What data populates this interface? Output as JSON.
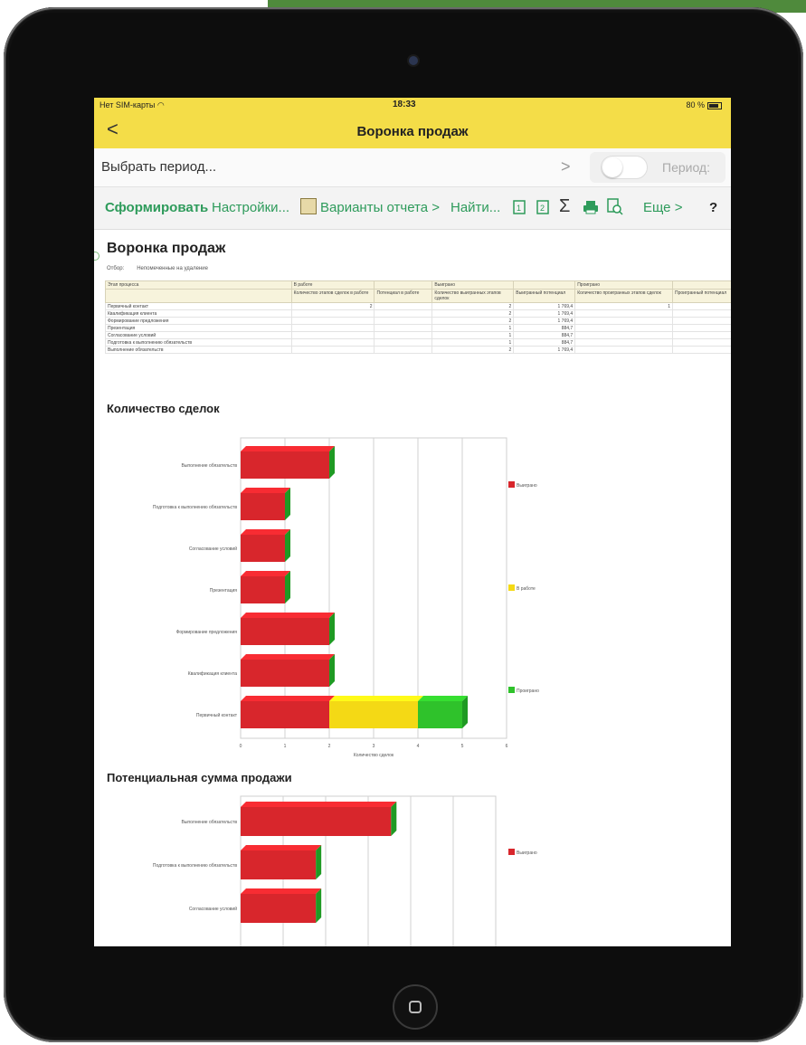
{
  "status": {
    "carrier": "Нет SIM-карты",
    "time": "18:33",
    "battery": "80 %"
  },
  "nav": {
    "back": "<",
    "title": "Воронка продаж"
  },
  "period": {
    "select": "Выбрать период...",
    "chevron": ">",
    "label": "Период:"
  },
  "toolbar": {
    "generate": "Сформировать",
    "settings": "Настройки...",
    "variants": "Варианты отчета >",
    "find": "Найти...",
    "sum": "Σ",
    "more": "Еще >",
    "help": "?"
  },
  "report": {
    "title": "Воронка продаж",
    "filter_label": "Отбор:",
    "filter_value": "Непомеченные на удаление"
  },
  "table": {
    "header_top": [
      "Этап процесса",
      "В работе",
      "",
      "Выиграно",
      "",
      "Проиграно",
      ""
    ],
    "header_sub": [
      "",
      "Количество этапов сделок в работе",
      "Потенциал в работе",
      "Количество выигранных этапов сделок",
      "Выигранный потенциал",
      "Количество проигранных этапов сделок",
      "Проигранный потенциал"
    ],
    "rows": [
      [
        "Первичный контакт",
        "2",
        "",
        "2",
        "1 769,4",
        "1",
        ""
      ],
      [
        "Квалификация клиента",
        "",
        "",
        "2",
        "1 769,4",
        "",
        ""
      ],
      [
        "Формирование предложения",
        "",
        "",
        "2",
        "1 769,4",
        "",
        ""
      ],
      [
        "Презентация",
        "",
        "",
        "1",
        "884,7",
        "",
        ""
      ],
      [
        "Согласование условий",
        "",
        "",
        "1",
        "884,7",
        "",
        ""
      ],
      [
        "Подготовка к выполнению обязательств",
        "",
        "",
        "1",
        "884,7",
        "",
        ""
      ],
      [
        "Выполнение обязательств",
        "",
        "",
        "2",
        "1 769,4",
        "",
        ""
      ]
    ]
  },
  "chart_data": [
    {
      "type": "bar",
      "orientation": "horizontal",
      "stacked": true,
      "title": "Количество сделок",
      "xlabel": "Количество сделок",
      "ylabel": "",
      "xlim": [
        0,
        6
      ],
      "xticks": [
        "0",
        "1",
        "2",
        "3",
        "4",
        "5",
        "6"
      ],
      "grid": true,
      "legend_position": "right",
      "categories": [
        "Выполнение обязательств",
        "Подготовка к выполнению обязательств",
        "Согласование условий",
        "Презентация",
        "Формирование предложения",
        "Квалификация клиента",
        "Первичный контакт"
      ],
      "series": [
        {
          "name": "Выиграно",
          "color": "#d8262c",
          "values": [
            2,
            1,
            1,
            1,
            2,
            2,
            2
          ]
        },
        {
          "name": "В работе",
          "color": "#f4d915",
          "values": [
            0,
            0,
            0,
            0,
            0,
            0,
            2
          ]
        },
        {
          "name": "Проиграно",
          "color": "#2fc22b",
          "values": [
            0,
            0,
            0,
            0,
            0,
            0,
            1
          ]
        }
      ]
    },
    {
      "type": "bar",
      "orientation": "horizontal",
      "stacked": true,
      "title": "Потенциальная сумма продажи",
      "grid": true,
      "legend_position": "right",
      "categories": [
        "Выполнение обязательств",
        "Подготовка к выполнению обязательств",
        "Согласование условий"
      ],
      "series": [
        {
          "name": "Выиграно",
          "color": "#d8262c",
          "values": [
            1769.4,
            884.7,
            884.7
          ]
        }
      ]
    }
  ]
}
